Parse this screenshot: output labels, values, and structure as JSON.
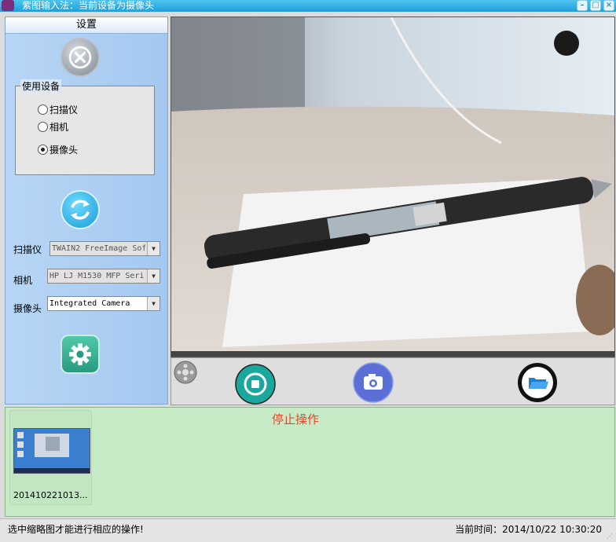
{
  "window": {
    "title": "紫图输入法：当前设备为摄像头",
    "controls": [
      "minimize",
      "maximize",
      "close"
    ]
  },
  "sidebar": {
    "header": "设置",
    "device_group": {
      "legend": "使用设备",
      "options": [
        {
          "label": "扫描仪",
          "checked": false
        },
        {
          "label": "相机",
          "checked": false
        },
        {
          "label": "摄像头",
          "checked": true
        }
      ]
    },
    "scanner": {
      "label": "扫描仪",
      "value": "TWAIN2 FreeImage Sof"
    },
    "camera": {
      "label": "相机",
      "value": "HP LJ M1530 MFP Seri"
    },
    "webcam": {
      "label": "摄像头",
      "value": "Integrated Camera"
    }
  },
  "toolbar": {
    "icons": [
      "film-reel-icon",
      "stop-icon",
      "camera-icon",
      "folder-icon"
    ]
  },
  "thumbnails": {
    "status": "停止操作",
    "items": [
      {
        "caption": "201410221013..."
      }
    ]
  },
  "statusbar": {
    "hint": "选中缩略图才能进行相应的操作!",
    "time_label": "当前时间：",
    "time_value": "2014/10/22 10:30:20"
  },
  "colors": {
    "titlebar": "#1f9ed8",
    "sidebar": "#a4c8f0",
    "thumb_area": "#c7ebc7",
    "status_text": "#e04a2a"
  }
}
